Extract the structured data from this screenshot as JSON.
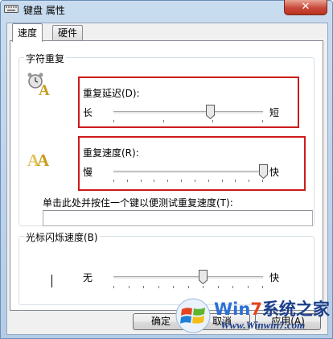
{
  "window": {
    "title": "键盘 属性",
    "close_glyph": "✕"
  },
  "tabs": [
    {
      "label": "速度",
      "active": true
    },
    {
      "label": "硬件",
      "active": false
    }
  ],
  "char_repeat": {
    "legend": "字符重复",
    "delay": {
      "label": "重复延迟(D):",
      "min_label": "长",
      "max_label": "短",
      "value_fraction": 0.65,
      "tick_count": 4
    },
    "rate": {
      "label": "重复速度(R):",
      "min_label": "慢",
      "max_label": "快",
      "value_fraction": 1.0,
      "tick_count": 12
    },
    "test": {
      "label": "单击此处并按住一个键以便测试重复速度(T):",
      "value": ""
    }
  },
  "cursor_blink": {
    "legend": "光标闪烁速度(B)",
    "min_label": "无",
    "max_label": "快",
    "value_fraction": 0.6,
    "tick_count": 11
  },
  "buttons": {
    "ok": "确定",
    "cancel": "取消",
    "apply": "应用(A)"
  },
  "watermark": {
    "title_w": "Win",
    "title_7": "7",
    "title_rest": "系统之家",
    "url": "Www.Winwin7.com"
  },
  "colors": {
    "highlight_box": "#cc1b1b",
    "window_frame": "#b5cce6",
    "close_button": "#c9483a"
  },
  "icons": {
    "window": "keyboard-icon",
    "delay": "alarm-clock-A-icon",
    "rate": "double-A-icon",
    "blink": "text-cursor-icon"
  }
}
